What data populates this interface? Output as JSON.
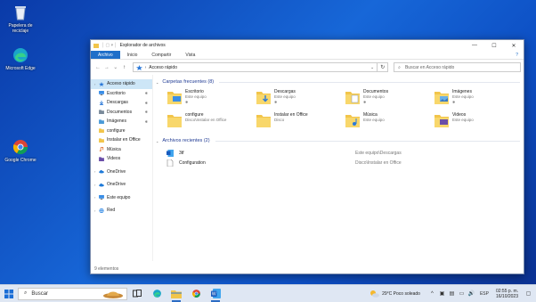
{
  "desktop": {
    "icons": [
      {
        "label": "Papelera de reciclaje"
      },
      {
        "label": "Microsoft Edge"
      },
      {
        "label": "Google Chrome"
      }
    ]
  },
  "window": {
    "title": "Explorador de archivos",
    "controls": {
      "minimize": "—",
      "maximize": "☐",
      "close": "✕"
    },
    "ribbon_tabs": [
      "Archivo",
      "Inicio",
      "Compartir",
      "Vista"
    ],
    "help": "?",
    "address": {
      "segment": "Acceso rápido",
      "separator": "›",
      "dropdown": "⌄",
      "refresh": "↻"
    },
    "search_placeholder": "Buscar en Acceso rápido",
    "nav_buttons": {
      "back": "←",
      "forward": "→",
      "recent": "⌄",
      "up": "↑"
    },
    "sidebar": [
      {
        "label": "Acceso rápido",
        "pinned": false,
        "selected": true,
        "icon": "star-icon",
        "color": "#2b79d8"
      },
      {
        "label": "Escritorio",
        "pinned": true,
        "icon": "desktop-icon",
        "color": "#3a8ee6"
      },
      {
        "label": "Descargas",
        "pinned": true,
        "icon": "download-icon",
        "color": "#2b79d8"
      },
      {
        "label": "Documentos",
        "pinned": true,
        "icon": "documents-icon",
        "color": "#7a8a9a"
      },
      {
        "label": "Imágenes",
        "pinned": true,
        "icon": "pictures-icon",
        "color": "#4a9ad8"
      },
      {
        "label": "configure",
        "pinned": false,
        "icon": "folder-icon",
        "color": "#f2c54a"
      },
      {
        "label": "Instalar en Office",
        "pinned": false,
        "icon": "folder-icon",
        "color": "#f2c54a"
      },
      {
        "label": "Música",
        "pinned": false,
        "icon": "music-icon",
        "color": "#e0702f"
      },
      {
        "label": "Videos",
        "pinned": false,
        "icon": "video-icon",
        "color": "#6a4ea8"
      },
      {
        "label": "OneDrive",
        "gap": true,
        "icon": "cloud-icon",
        "color": "#1f7ad8"
      },
      {
        "label": "OneDrive",
        "gap": true,
        "icon": "cloud-icon",
        "color": "#1f7ad8"
      },
      {
        "label": "Este equipo",
        "gap": true,
        "icon": "computer-icon",
        "color": "#3a8ee6"
      },
      {
        "label": "Red",
        "gap": true,
        "icon": "network-icon",
        "color": "#3a8ee6"
      }
    ],
    "pin_glyph": "✱",
    "frequent": {
      "header": "Carpetas frecuentes (8)",
      "items": [
        {
          "name": "Escritorio",
          "sub": "Este equipo",
          "pinned": true,
          "icon": "desktop-folder-icon"
        },
        {
          "name": "Descargas",
          "sub": "Este equipo",
          "pinned": true,
          "icon": "downloads-folder-icon"
        },
        {
          "name": "Documentos",
          "sub": "Este equipo",
          "pinned": true,
          "icon": "documents-folder-icon"
        },
        {
          "name": "Imágenes",
          "sub": "Este equipo",
          "pinned": true,
          "icon": "pictures-folder-icon"
        },
        {
          "name": "configure",
          "sub": "Disco\\Instalar en Office",
          "pinned": false,
          "icon": "folder-icon"
        },
        {
          "name": "Instalar en Office",
          "sub": "Disco",
          "pinned": false,
          "icon": "folder-icon"
        },
        {
          "name": "Música",
          "sub": "Este equipo",
          "pinned": false,
          "icon": "music-folder-icon"
        },
        {
          "name": "Videos",
          "sub": "Este equipo",
          "pinned": false,
          "icon": "videos-folder-icon"
        }
      ]
    },
    "recent": {
      "header": "Archivos recientes (2)",
      "items": [
        {
          "name": "3tf",
          "location": "Este equipo\\Descargas",
          "icon": "word-file-icon"
        },
        {
          "name": "Configuration",
          "location": "Disco\\Instalar en Office",
          "icon": "file-icon"
        }
      ]
    },
    "status": "9 elementos"
  },
  "taskbar": {
    "search_label": "Buscar",
    "weather": "29°C  Poco soleado",
    "time": "02:55 p. m.",
    "date": "16/10/2023",
    "language": "ESP",
    "tray_glyphs": {
      "chevron": "^",
      "sound": "🔊",
      "network": "▭",
      "notifications": "▢"
    }
  },
  "colors": {
    "accent": "#1f6fc9",
    "folder": "#f2c54a",
    "selection": "#cde6f7"
  }
}
